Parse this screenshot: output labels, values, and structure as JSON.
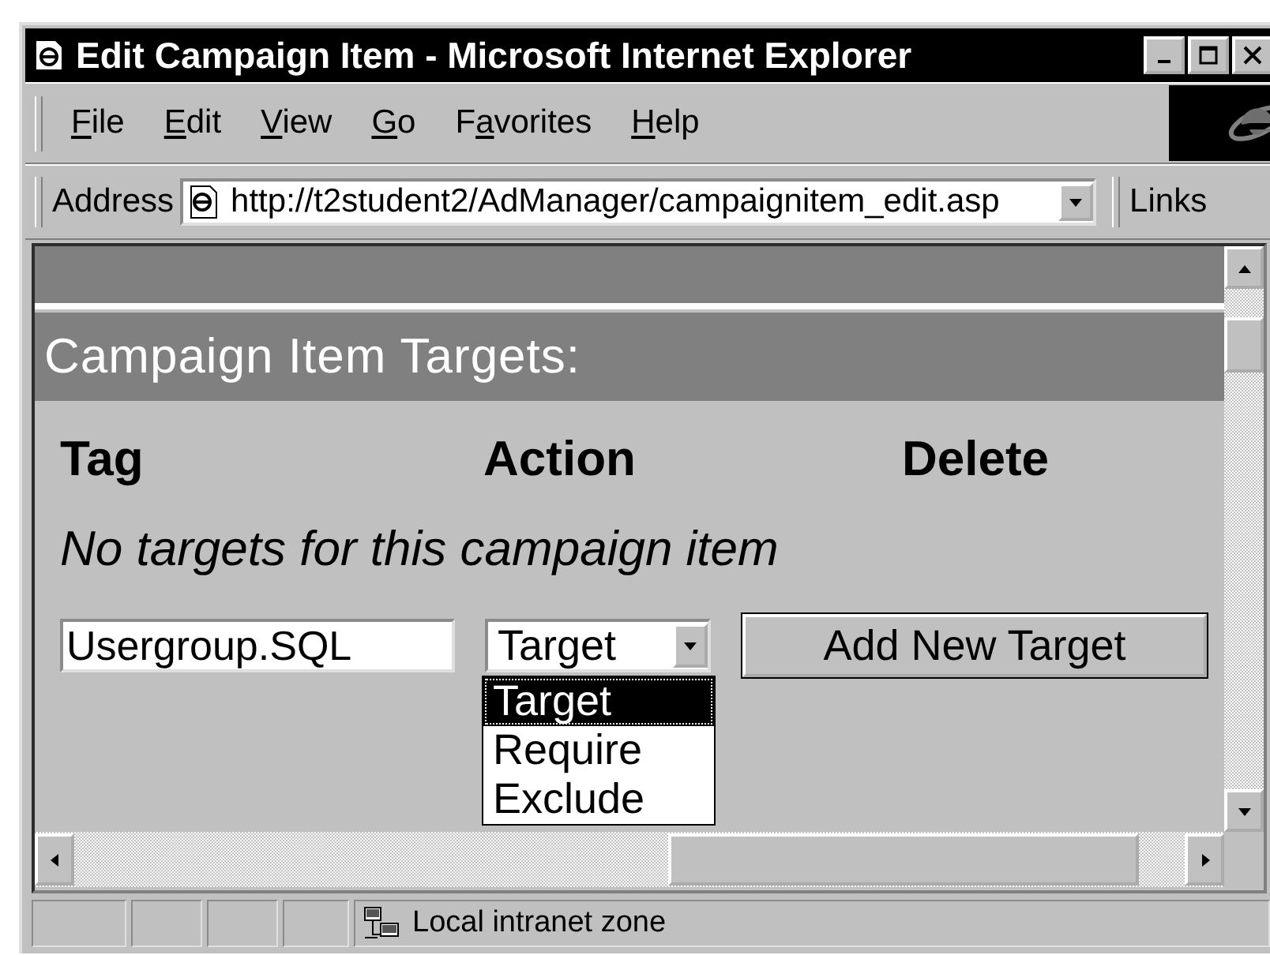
{
  "window": {
    "title": "Edit Campaign Item - Microsoft Internet Explorer"
  },
  "menu": [
    {
      "key": "F",
      "post": "ile"
    },
    {
      "key": "E",
      "post": "dit"
    },
    {
      "key": "V",
      "post": "iew"
    },
    {
      "key": "G",
      "post": "o"
    },
    {
      "pre": "F",
      "key": "a",
      "post": "vorites"
    },
    {
      "key": "H",
      "post": "elp"
    }
  ],
  "address_bar": {
    "label": "Address",
    "url": "http://t2student2/AdManager/campaignitem_edit.asp",
    "links": "Links"
  },
  "page": {
    "section_title": "Campaign Item Targets:",
    "columns": [
      "Tag",
      "Action",
      "Delete"
    ],
    "empty_message": "No targets for this campaign item",
    "tag_field": {
      "value": "Usergroup.SQL"
    },
    "action_select": {
      "value": "Target",
      "expanded": true,
      "options": [
        {
          "label": "Target",
          "selected": true
        },
        {
          "label": "Require",
          "selected": false
        },
        {
          "label": "Exclude",
          "selected": false
        }
      ]
    },
    "add_button": "Add New Target"
  },
  "status_bar": {
    "zone": "Local intranet zone"
  }
}
